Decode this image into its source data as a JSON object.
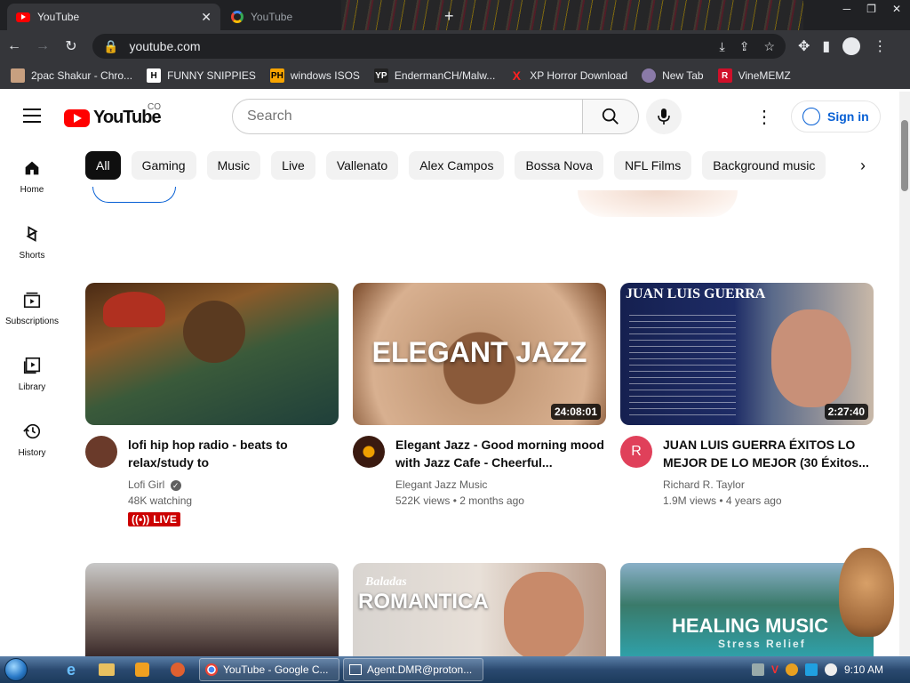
{
  "browser": {
    "tabs": [
      {
        "title": "YouTube",
        "active": true
      },
      {
        "title": "YouTube",
        "active": false
      }
    ],
    "url": "youtube.com",
    "bookmarks": [
      {
        "label": "2pac Shakur - Chro...",
        "icon": "record-icon"
      },
      {
        "label": "FUNNY SNIPPIES",
        "icon": "H"
      },
      {
        "label": "windows ISOS",
        "icon": "PH"
      },
      {
        "label": "EndermanCH/Malw...",
        "icon": "YP"
      },
      {
        "label": "XP Horror Download",
        "icon": "X"
      },
      {
        "label": "New Tab",
        "icon": "chrome-icon"
      },
      {
        "label": "VineMEMZ",
        "icon": "R"
      }
    ]
  },
  "youtube": {
    "logo_text": "YouTube",
    "country_code": "CO",
    "search_placeholder": "Search",
    "signin_label": "Sign in",
    "sidebar": [
      {
        "label": "Home",
        "icon": "home-icon"
      },
      {
        "label": "Shorts",
        "icon": "shorts-icon"
      },
      {
        "label": "Subscriptions",
        "icon": "subscriptions-icon"
      },
      {
        "label": "Library",
        "icon": "library-icon"
      },
      {
        "label": "History",
        "icon": "history-icon"
      }
    ],
    "chips": [
      "All",
      "Gaming",
      "Music",
      "Live",
      "Vallenato",
      "Alex Campos",
      "Bossa Nova",
      "NFL Films",
      "Background music"
    ],
    "videos": [
      {
        "title": "lofi hip hop radio - beats to relax/study to",
        "channel": "Lofi Girl",
        "verified": true,
        "stats": "48K watching",
        "live_label": "LIVE",
        "duration": ""
      },
      {
        "title": "Elegant Jazz - Good morning mood with Jazz Cafe - Cheerful...",
        "channel": "Elegant Jazz Music",
        "stats": "522K views • 2 months ago",
        "duration": "24:08:01",
        "thumb_text": "ELEGANT JAZZ"
      },
      {
        "title": "JUAN LUIS GUERRA ÉXITOS LO MEJOR DE LO MEJOR (30 Éxitos...",
        "channel": "Richard R. Taylor",
        "avatar_letter": "R",
        "stats": "1.9M views • 4 years ago",
        "duration": "2:27:40",
        "thumb_text": "JUAN LUIS GUERRA"
      }
    ],
    "row2": [
      {
        "thumb_text": ""
      },
      {
        "thumb_text": "ROMANTICA",
        "thumb_sub": "Baladas"
      },
      {
        "thumb_text": "HEALING MUSIC",
        "thumb_sub": "Stress Relief"
      }
    ]
  },
  "taskbar": {
    "tasks": [
      {
        "label": "YouTube - Google C...",
        "icon": "chrome-icon"
      },
      {
        "label": "Agent.DMR@proton...",
        "icon": "window-icon"
      }
    ],
    "clock": "9:10 AM"
  }
}
